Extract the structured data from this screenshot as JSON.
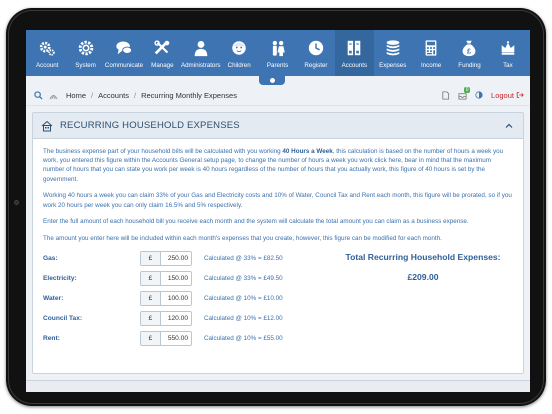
{
  "nav": {
    "items": [
      {
        "label": "Account",
        "icon": "gears-icon"
      },
      {
        "label": "System",
        "icon": "gear-icon"
      },
      {
        "label": "Communicate",
        "icon": "chat-icon"
      },
      {
        "label": "Manage",
        "icon": "tools-icon"
      },
      {
        "label": "Administrators",
        "icon": "user-icon"
      },
      {
        "label": "Children",
        "icon": "child-icon"
      },
      {
        "label": "Parents",
        "icon": "parents-icon"
      },
      {
        "label": "Register",
        "icon": "clock-icon"
      },
      {
        "label": "Accounts",
        "icon": "ledger-icon"
      },
      {
        "label": "Expenses",
        "icon": "coins-icon"
      },
      {
        "label": "Income",
        "icon": "calculator-icon"
      },
      {
        "label": "Funding",
        "icon": "moneybag-icon"
      },
      {
        "label": "Tax",
        "icon": "crown-icon"
      }
    ]
  },
  "breadcrumb": {
    "home": "Home",
    "section": "Accounts",
    "current": "Recurring Monthly Expenses"
  },
  "topright": {
    "badge_count": "0",
    "logout_label": "Logout"
  },
  "panel": {
    "title": "RECURRING HOUSEHOLD EXPENSES",
    "intro_a": "The business expense part of your household bills will be calculated with you working ",
    "intro_bold": "40 Hours a Week",
    "intro_b": ", this calculation is based on the number of hours a week you work, you entered this figure within the Accounts General setup page, to change the number of hours a week you work click here, bear in mind that the maximum number of hours that you can state you work per week is 40 hours regardless of the number of hours that you actually work, this figure of 40 hours is set by the government.",
    "para2": "Working 40 hours a week you can claim 33% of your Gas and Electricity costs and 10% of Water, Council Tax and Rent each month, this figure will be prorated, so if you work 20 hours per week you can only claim 16.5% and 5% respectively.",
    "para3": "Enter the full amount of each household bill you receive each month and the system will calculate the total amount you can claim as a business expense.",
    "para4": "The amount you enter here will be included within each month's expenses that you create, however, this figure can be modified for each month."
  },
  "bills": [
    {
      "label": "Gas:",
      "currency": "£",
      "amount": "250.00",
      "calc": "Calculated @ 33% = £82.50"
    },
    {
      "label": "Electricity:",
      "currency": "£",
      "amount": "150.00",
      "calc": "Calculated @ 33% = £49.50"
    },
    {
      "label": "Water:",
      "currency": "£",
      "amount": "100.00",
      "calc": "Calculated @ 10% = £10.00"
    },
    {
      "label": "Council Tax:",
      "currency": "£",
      "amount": "120.00",
      "calc": "Calculated @ 10% = £12.00"
    },
    {
      "label": "Rent:",
      "currency": "£",
      "amount": "550.00",
      "calc": "Calculated @ 10% = £55.00"
    }
  ],
  "total": {
    "title": "Total Recurring Household Expenses:",
    "value": "£209.00"
  },
  "colors": {
    "nav_bg": "#3e74b2",
    "text_blue": "#3b70ad",
    "logout_red": "#c0282d"
  }
}
